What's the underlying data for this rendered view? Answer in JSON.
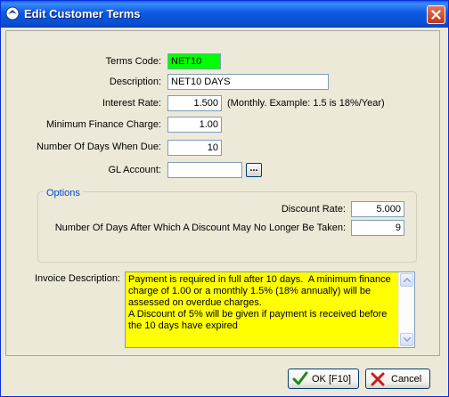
{
  "window": {
    "title": "Edit Customer Terms",
    "colors": {
      "titlebar": "#0A4FD0",
      "terms_code_bg": "#00FF00",
      "description_bg": "#FFFF00"
    }
  },
  "form": {
    "terms_code_label": "Terms Code:",
    "terms_code_value": "NET10",
    "description_label": "Description:",
    "description_value": "NET10 DAYS",
    "interest_rate_label": "Interest Rate:",
    "interest_rate_value": "1.500",
    "interest_rate_note": "(Monthly.  Example: 1.5 is 18%/Year)",
    "min_finance_label": "Minimum Finance Charge:",
    "min_finance_value": "1.00",
    "days_due_label": "Number Of Days When Due:",
    "days_due_value": "10",
    "gl_account_label": "GL Account:",
    "gl_account_value": "",
    "browse_label": "..."
  },
  "options": {
    "legend": "Options",
    "discount_rate_label": "Discount Rate:",
    "discount_rate_value": "5.000",
    "discount_days_label": "Number Of Days After Which A  Discount May No Longer Be Taken:",
    "discount_days_value": "9"
  },
  "invoice": {
    "label": "Invoice Description:",
    "text": "Payment is required in full after 10 days.  A minimum finance charge of 1.00 or a monthly 1.5% (18% annually) will be assessed on overdue charges.\nA Discount of 5% will be given if payment is received before the 10 days have expired"
  },
  "buttons": {
    "ok_label": "OK [F10]",
    "cancel_label": "Cancel"
  },
  "icons": [
    "app-icon",
    "close-icon",
    "checkmark-icon",
    "x-cancel-icon",
    "scroll-up-icon",
    "scroll-down-icon"
  ]
}
